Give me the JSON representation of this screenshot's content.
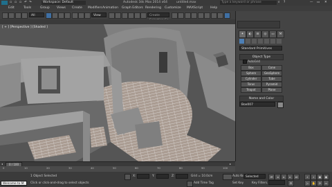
{
  "titlebar": {
    "workspace_label": "Workspace: Default",
    "filename": "Autodesk 3ds Max 2014 x64",
    "document": "untitled.max",
    "search_placeholder": "Type a keyword or phrase"
  },
  "menu": {
    "items": [
      "Edit",
      "Tools",
      "Group",
      "Views",
      "Create",
      "Modifiers",
      "Animation",
      "Graph Editors",
      "Rendering",
      "Customize",
      "MAXScript",
      "Help"
    ]
  },
  "toolbar": {
    "filter_value": "All",
    "view_value": "View",
    "selection_set_placeholder": "Create Selection Se"
  },
  "viewport": {
    "label": "[ + ] [Perspective ] [Shaded ]"
  },
  "command_panel": {
    "category": "Standard Primitives",
    "object_type_header": "Object Type",
    "autogrid_label": "AutoGrid",
    "buttons": [
      "Box",
      "Cone",
      "Sphere",
      "GeoSphere",
      "Cylinder",
      "Tube",
      "Torus",
      "Pyramid",
      "Teapot",
      "Plane"
    ],
    "name_color_header": "Name and Color",
    "name_value": "Box007"
  },
  "timeline": {
    "frame_label": "0 / 100",
    "ticks": [
      "0",
      "10",
      "20",
      "30",
      "40",
      "50",
      "60",
      "70",
      "80",
      "90",
      "100"
    ]
  },
  "status": {
    "welcome": "Welcome to M",
    "selection_text": "1 Object Selected",
    "prompt_text": "Click or click-and-drag to select objects",
    "x_label": "X:",
    "y_label": "Y:",
    "z_label": "Z:",
    "grid_text": "Grid = 10.0cm",
    "auto_key": "Auto Key",
    "selected_value": "Selected",
    "set_key": "Set Key",
    "key_filters": "Key Filters...",
    "add_time_tag": "Add Time Tag"
  },
  "colors": {
    "accent_blue": "#3f6fa3",
    "floor": "#a6988e",
    "wall": "#8e8e8e",
    "auto_key_red": "#b33a3a"
  }
}
